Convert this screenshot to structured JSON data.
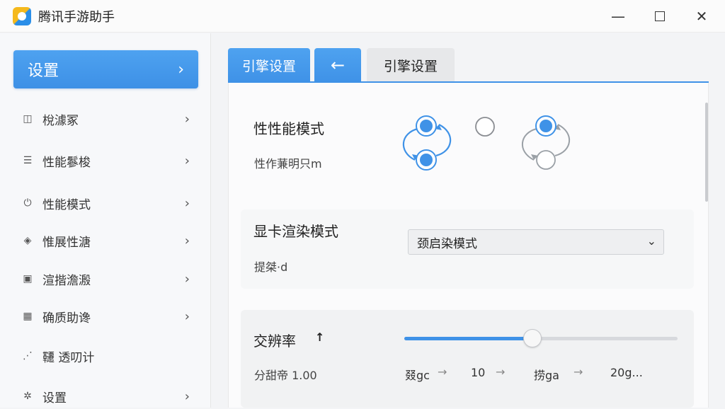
{
  "window": {
    "title": "腾讯手游助手",
    "minimize": "—",
    "close": "✕"
  },
  "sidebar": {
    "header": {
      "label": "设置",
      "chevron": "›"
    },
    "items": [
      {
        "icon": "performance-icon",
        "glyph": "◫",
        "label": "梲澽冢"
      },
      {
        "icon": "doc-icon",
        "glyph": "☰",
        "label": "性能鬖梭"
      },
      {
        "icon": "power-icon",
        "glyph": "⏻",
        "label": "性能模式"
      },
      {
        "icon": "diamond-icon",
        "glyph": "◈",
        "label": "惟展性溏"
      },
      {
        "icon": "card-icon",
        "glyph": "▣",
        "label": "渲揩澹溵"
      },
      {
        "icon": "calendar-icon",
        "glyph": "▦",
        "label": "确质助谗"
      },
      {
        "icon": "chart-icon",
        "glyph": "⋰",
        "label": "韆 透叨计"
      },
      {
        "icon": "gear-icon",
        "glyph": "✲",
        "label": "设置"
      }
    ],
    "chevron": "›"
  },
  "tabs": {
    "active": "引擎设置",
    "back": "←",
    "second": "引擎设置"
  },
  "performance_mode": {
    "title": "性性能模式",
    "subtitle": "性作蒹明只m",
    "options": [
      {
        "name": "dual-selected",
        "selected": true
      },
      {
        "name": "single",
        "selected": false
      },
      {
        "name": "top-selected",
        "selected": true
      }
    ]
  },
  "render_mode": {
    "title": "显卡渲染模式",
    "subtitle": "提桀·d",
    "selected": "颈启染模式",
    "chevron": "⌄"
  },
  "resolution": {
    "title": "交辨率",
    "title_icon": "↑",
    "subtitle": "分甜帝 1.00",
    "slider_value": 0.47,
    "steps": [
      "叕gc",
      "10",
      "捞ga",
      "20g..."
    ],
    "arrows": [
      "→",
      "→",
      "→"
    ]
  },
  "colors": {
    "accent": "#3f92e7",
    "accent_light": "#4ea2f0"
  }
}
